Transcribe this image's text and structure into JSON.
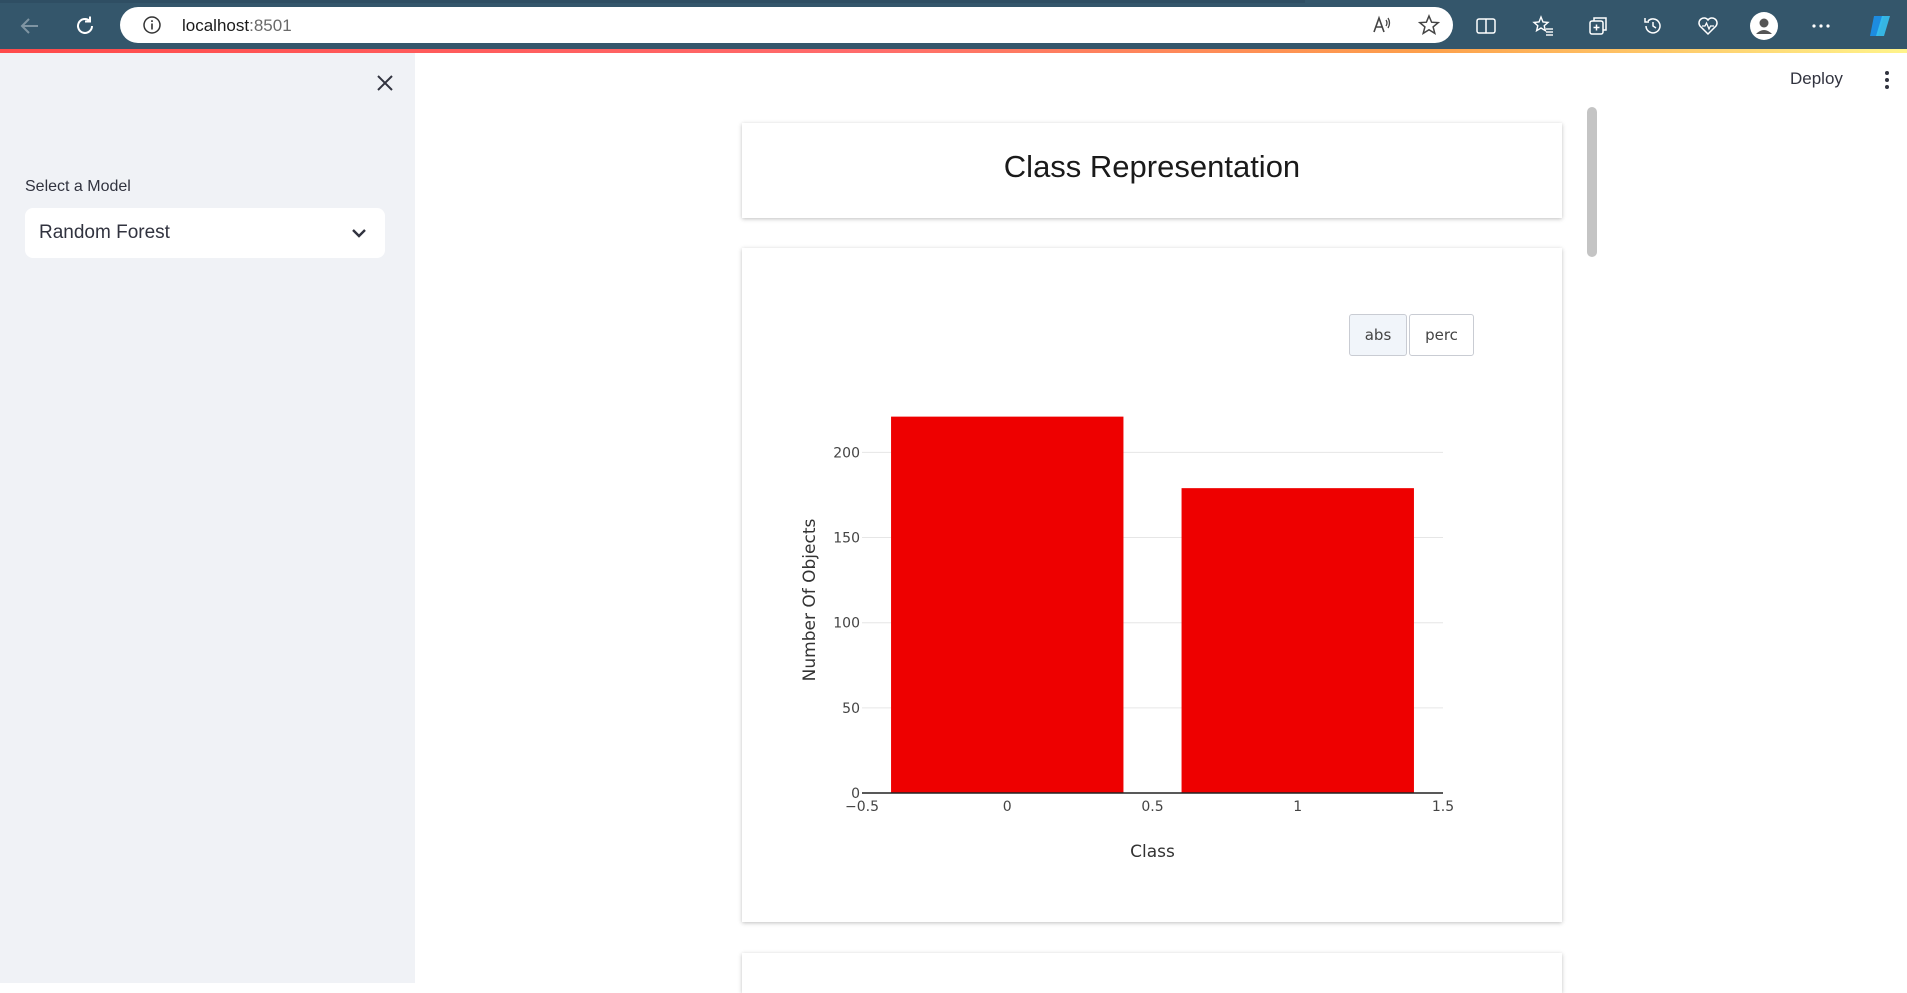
{
  "browser": {
    "url_host": "localhost",
    "url_port": ":8501"
  },
  "sidebar": {
    "select_label": "Select a Model",
    "selected_model": "Random Forest"
  },
  "header": {
    "deploy_label": "Deploy"
  },
  "main": {
    "title": "Class Representation",
    "toggle": {
      "abs_label": "abs",
      "perc_label": "perc",
      "active": "abs"
    }
  },
  "colors": {
    "bar": "#ee0000",
    "sidebar_bg": "#f0f2f6",
    "browser_bar": "#34566b"
  },
  "chart_data": {
    "type": "bar",
    "x": [
      0,
      1
    ],
    "values": [
      221,
      179
    ],
    "xlabel": "Class",
    "ylabel": "Number Of Objects",
    "xlim": [
      -0.5,
      1.5
    ],
    "ylim": [
      0,
      229
    ],
    "x_ticks": [
      -0.5,
      0,
      0.5,
      1,
      1.5
    ],
    "x_tick_labels": [
      "−0.5",
      "0",
      "0.5",
      "1",
      "1.5"
    ],
    "y_ticks": [
      0,
      50,
      100,
      150,
      200
    ],
    "bar_width": 0.8,
    "grid": true
  }
}
